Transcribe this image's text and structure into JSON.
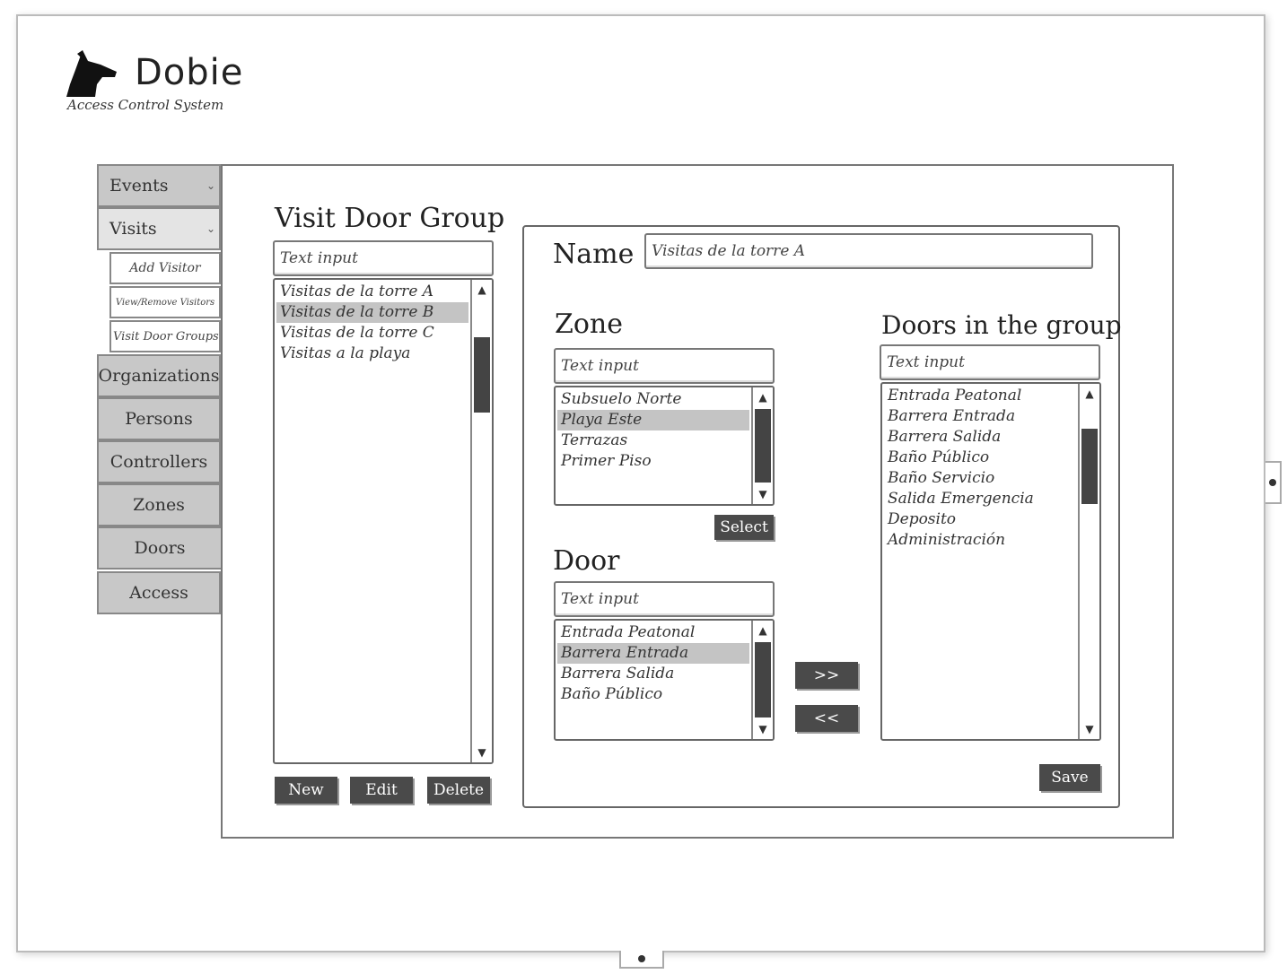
{
  "logo": {
    "title": "Dobie",
    "subtitle": "Access Control System"
  },
  "sidebar": {
    "items": [
      {
        "label": "Events",
        "chevron": "⌄"
      },
      {
        "label": "Visits",
        "chevron": "⌄"
      },
      {
        "label": "Organizations"
      },
      {
        "label": "Persons"
      },
      {
        "label": "Controllers"
      },
      {
        "label": "Zones"
      },
      {
        "label": "Doors"
      },
      {
        "label": "Access"
      }
    ],
    "visits_submenu": [
      "Add Visitor",
      "View/Remove Visitors",
      "Visit Door Groups"
    ]
  },
  "group_panel": {
    "title": "Visit Door Group",
    "search_placeholder": "Text input",
    "items": [
      "Visitas de la torre A",
      "Visitas de la torre B",
      "Visitas de la torre C",
      "Visitas a la playa"
    ],
    "selected_index": 1,
    "buttons": {
      "new": "New",
      "edit": "Edit",
      "delete": "Delete"
    }
  },
  "detail": {
    "name_label": "Name",
    "name_value": "Visitas de la torre A",
    "zone": {
      "label": "Zone",
      "search_placeholder": "Text input",
      "items": [
        "Subsuelo Norte",
        "Playa Este",
        "Terrazas",
        "Primer Piso"
      ],
      "selected_index": 1,
      "select_button": "Select"
    },
    "door": {
      "label": "Door",
      "search_placeholder": "Text input",
      "items": [
        "Entrada Peatonal",
        "Barrera Entrada",
        "Barrera Salida",
        "Baño Público"
      ],
      "selected_index": 1
    },
    "add_button": ">>",
    "remove_button": "<<",
    "doors_in_group": {
      "label": "Doors in the group",
      "search_placeholder": "Text input",
      "items": [
        "Entrada Peatonal",
        "Barrera Entrada",
        "Barrera Salida",
        "Baño Público",
        "Baño Servicio",
        "Salida Emergencia",
        "Deposito",
        "Administración"
      ]
    },
    "save_button": "Save"
  },
  "icons": {
    "logo": "dog-head-icon",
    "chevron": "chevron-down-icon",
    "scroll_up": "triangle-up-icon",
    "scroll_down": "triangle-down-icon"
  }
}
